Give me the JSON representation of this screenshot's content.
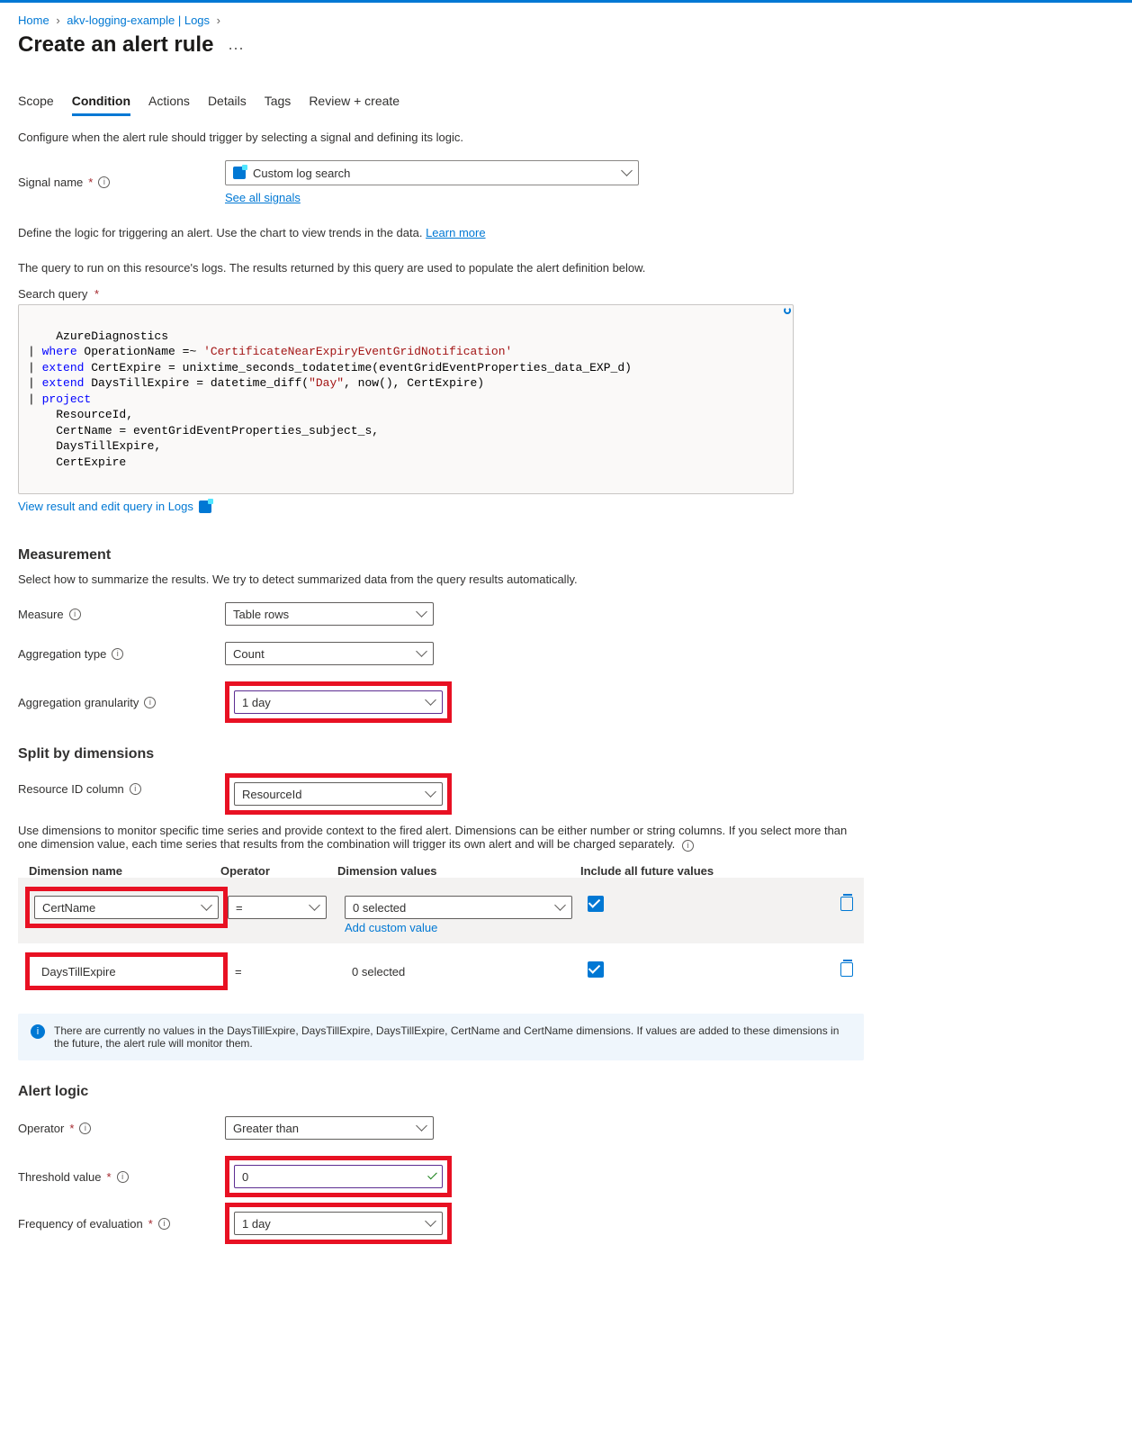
{
  "breadcrumb": {
    "home": "Home",
    "item2": "akv-logging-example | Logs"
  },
  "page_title": "Create an alert rule",
  "tabs": [
    "Scope",
    "Condition",
    "Actions",
    "Details",
    "Tags",
    "Review + create"
  ],
  "condition": {
    "desc": "Configure when the alert rule should trigger by selecting a signal and defining its logic.",
    "signal_name_label": "Signal name",
    "signal_value": "Custom log search",
    "see_all": "See all signals",
    "define_logic": "Define the logic for triggering an alert. Use the chart to view trends in the data. ",
    "learn_more": "Learn more",
    "query_intro": "The query to run on this resource's logs. The results returned by this query are used to populate the alert definition below.",
    "search_query_label": "Search query",
    "query_lines": [
      {
        "t": "plain",
        "v": "AzureDiagnostics"
      },
      {
        "t": "pipe",
        "v": [
          {
            "t": "blue",
            "v": "where"
          },
          {
            "t": "plain",
            "v": " OperationName =~ "
          },
          {
            "t": "red",
            "v": "'CertificateNearExpiryEventGridNotification'"
          }
        ]
      },
      {
        "t": "pipe",
        "v": [
          {
            "t": "blue",
            "v": "extend"
          },
          {
            "t": "plain",
            "v": " CertExpire = unixtime_seconds_todatetime(eventGridEventProperties_data_EXP_d)"
          }
        ]
      },
      {
        "t": "pipe",
        "v": [
          {
            "t": "blue",
            "v": "extend"
          },
          {
            "t": "plain",
            "v": " DaysTillExpire = datetime_diff("
          },
          {
            "t": "red",
            "v": "\"Day\""
          },
          {
            "t": "plain",
            "v": ", now(), CertExpire)"
          }
        ]
      },
      {
        "t": "pipe",
        "v": [
          {
            "t": "blue",
            "v": "project"
          }
        ]
      },
      {
        "t": "indent",
        "v": "    ResourceId,"
      },
      {
        "t": "indent",
        "v": "    CertName = eventGridEventProperties_subject_s,"
      },
      {
        "t": "indent",
        "v": "    DaysTillExpire,"
      },
      {
        "t": "indent",
        "v": "    CertExpire"
      }
    ],
    "view_logs": "View result and edit query in Logs"
  },
  "measurement": {
    "header": "Measurement",
    "desc": "Select how to summarize the results. We try to detect summarized data from the query results automatically.",
    "measure_label": "Measure",
    "measure_value": "Table rows",
    "agg_type_label": "Aggregation type",
    "agg_type_value": "Count",
    "agg_gran_label": "Aggregation granularity",
    "agg_gran_value": "1 day"
  },
  "split": {
    "header": "Split by dimensions",
    "resource_label": "Resource ID column",
    "resource_value": "ResourceId",
    "desc": "Use dimensions to monitor specific time series and provide context to the fired alert. Dimensions can be either number or string columns. If you select more than one dimension value, each time series that results from the combination will trigger its own alert and will be charged separately.",
    "cols": {
      "name": "Dimension name",
      "op": "Operator",
      "val": "Dimension values",
      "future": "Include all future values"
    },
    "rows": [
      {
        "name": "CertName",
        "op": "=",
        "val": "0 selected",
        "add": "Add custom value"
      },
      {
        "name": "DaysTillExpire",
        "op": "=",
        "val": "0 selected"
      }
    ],
    "info": "There are currently no values in the DaysTillExpire, DaysTillExpire, DaysTillExpire, CertName and CertName dimensions. If values are added to these dimensions in the future, the alert rule will monitor them."
  },
  "alert": {
    "header": "Alert logic",
    "op_label": "Operator",
    "op_value": "Greater than",
    "thresh_label": "Threshold value",
    "thresh_value": "0",
    "freq_label": "Frequency of evaluation",
    "freq_value": "1 day"
  }
}
